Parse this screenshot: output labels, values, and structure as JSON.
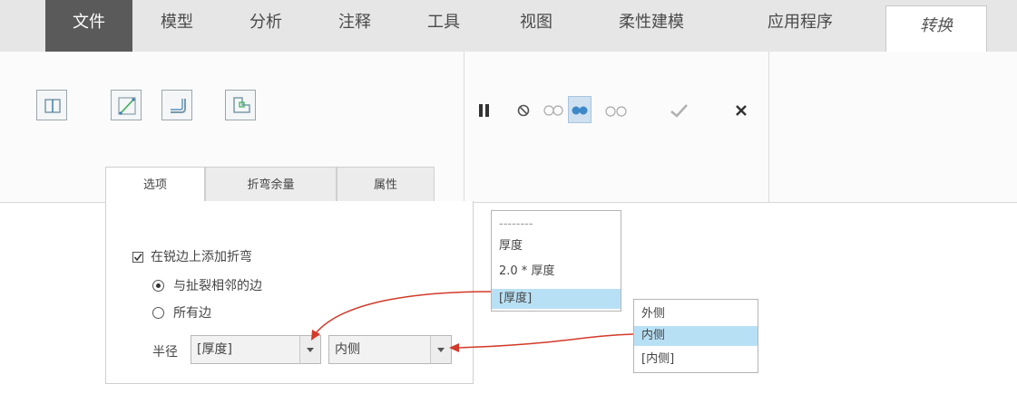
{
  "menubar": {
    "file": "文件",
    "tabs": [
      "模型",
      "分析",
      "注释",
      "工具",
      "视图",
      "柔性建模",
      "应用程序"
    ],
    "active_tab": "转换"
  },
  "subtabs": [
    "选项",
    "折弯余量",
    "属性"
  ],
  "options": {
    "add_bends_label": "在锐边上添加折弯",
    "add_bends_checked": true,
    "radio_adjacent": "与扯裂相邻的边",
    "radio_all": "所有边",
    "radio_selected": "adjacent",
    "radius_label": "半径",
    "radius_value": "[厚度]",
    "side_value": "内侧"
  },
  "radius_popup": {
    "items": [
      "--------",
      "厚度",
      "2.0 * 厚度",
      "[厚度]"
    ],
    "highlighted": "[厚度]"
  },
  "side_popup": {
    "items": [
      "外侧",
      "内侧",
      "[内侧]"
    ],
    "highlighted": "内侧"
  },
  "colors": {
    "arrow": "#d23a2a",
    "highlight": "#b8e0f5",
    "file_tab": "#5a5a5a"
  },
  "icons": [
    "edge-rip-icon",
    "sketch-edge-rip-icon",
    "edge-bend-icon",
    "corner-relief-icon",
    "pause-icon",
    "no-preview-icon",
    "static-preview-icon",
    "dynamic-preview-icon",
    "verify-preview-icon",
    "ok-check-icon",
    "cancel-x-icon"
  ]
}
